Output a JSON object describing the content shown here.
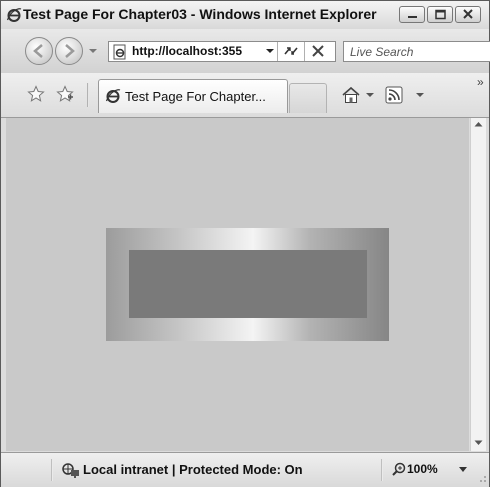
{
  "window": {
    "title": "Test Page For Chapter03 - Windows Internet Explorer"
  },
  "nav": {
    "address": "http://localhost:355",
    "search_placeholder": "Live Search"
  },
  "tabs": [
    {
      "label": "Test Page For Chapter..."
    }
  ],
  "toolbar": {
    "overflow_label": "»"
  },
  "status": {
    "zone": "Local intranet | Protected Mode: On",
    "zoom": "100%"
  },
  "colors": {
    "page_background": "#c9c9c9",
    "inner_rect": "#7a7a7a"
  }
}
